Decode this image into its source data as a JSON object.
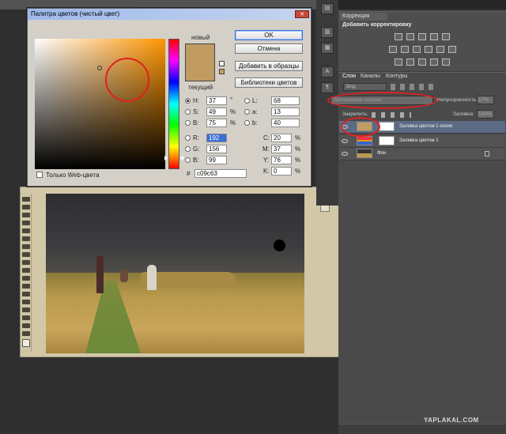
{
  "picker": {
    "title": "Палитра цветов (чистый цвет)",
    "close": "✕",
    "new_label": "новый",
    "current_label": "текущий",
    "ok": "OK",
    "cancel": "Отмена",
    "add_swatches": "Добавить в образцы",
    "libraries": "Библиотеки цветов",
    "web_only": "Только Web-цвета",
    "new_color": "#c09c63",
    "current_color": "#c09c63",
    "fields": {
      "H": {
        "label": "H:",
        "value": "37",
        "unit": "°"
      },
      "S": {
        "label": "S:",
        "value": "49",
        "unit": "%"
      },
      "B": {
        "label": "B:",
        "value": "75",
        "unit": "%"
      },
      "R": {
        "label": "R:",
        "value": "192"
      },
      "G": {
        "label": "G:",
        "value": "156"
      },
      "Bv": {
        "label": "B:",
        "value": "99"
      },
      "L": {
        "label": "L:",
        "value": "68"
      },
      "a": {
        "label": "a:",
        "value": "13"
      },
      "b": {
        "label": "b:",
        "value": "40"
      },
      "C": {
        "label": "C:",
        "value": "20",
        "unit": "%"
      },
      "M": {
        "label": "M:",
        "value": "37",
        "unit": "%"
      },
      "Y": {
        "label": "Y:",
        "value": "76",
        "unit": "%"
      },
      "K": {
        "label": "K:",
        "value": "0",
        "unit": "%"
      }
    },
    "hex_label": "#",
    "hex": "c09c63"
  },
  "panels": {
    "correction_tab": "Коррекция",
    "add_correction": "Добавить корректировку",
    "layer_tabs": [
      "Слои",
      "Каналы",
      "Контуры"
    ],
    "kind": "Вид",
    "blend_mode": "Затемнение основы",
    "opacity_label": "Непрозрачность:",
    "opacity_value": "17%",
    "lock_label": "Закрепить:",
    "fill_label": "Заливка:",
    "fill_value": "100%",
    "layers": [
      {
        "name": "Заливка цветом 1 копия"
      },
      {
        "name": "Заливка цветом 1"
      },
      {
        "name": "Фон"
      }
    ]
  },
  "watermark": "YAPLAKAL.COM"
}
